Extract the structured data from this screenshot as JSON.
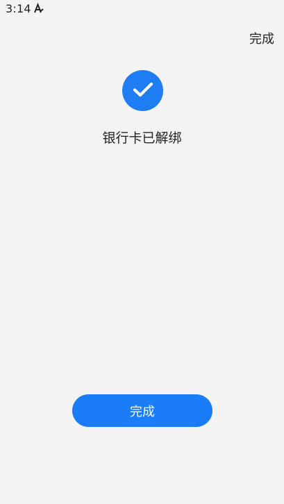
{
  "status_bar": {
    "time": "3:14",
    "icon": "accessibility-a-icon"
  },
  "header": {
    "done_label": "完成"
  },
  "result": {
    "icon": "checkmark-icon",
    "message": "银行卡已解绑"
  },
  "footer": {
    "done_button_label": "完成"
  },
  "colors": {
    "accent": "#1e7df2",
    "button": "#1a7cf7",
    "background": "#f4f4f4",
    "text": "#222222"
  }
}
